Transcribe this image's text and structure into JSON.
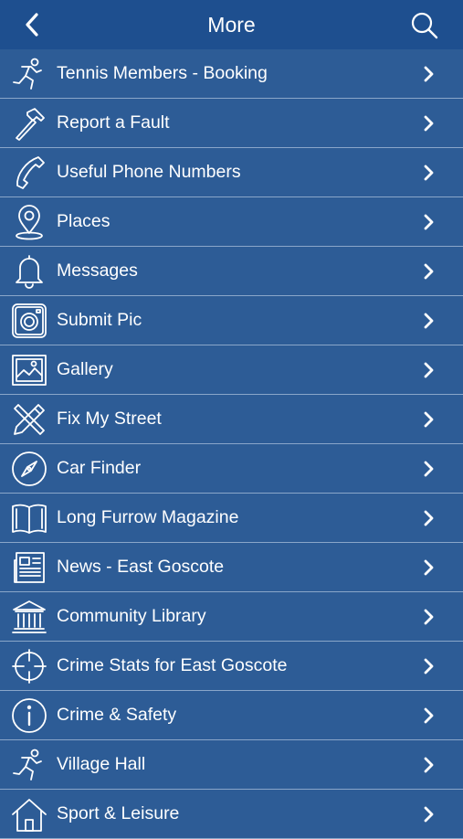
{
  "header": {
    "title": "More",
    "back_icon": "chevron-left-icon",
    "search_icon": "search-icon"
  },
  "colors": {
    "header_bg": "#1e4f8f",
    "list_bg": "#2d5c96",
    "divider": "#8aa6c9",
    "text": "#ffffff"
  },
  "items": [
    {
      "label": "Tennis Members - Booking",
      "icon": "running-person-icon"
    },
    {
      "label": "Report a Fault",
      "icon": "hammer-icon"
    },
    {
      "label": "Useful Phone Numbers",
      "icon": "phone-icon"
    },
    {
      "label": "Places",
      "icon": "map-pin-icon"
    },
    {
      "label": "Messages",
      "icon": "bell-icon"
    },
    {
      "label": "Submit Pic",
      "icon": "camera-icon"
    },
    {
      "label": "Gallery",
      "icon": "picture-icon"
    },
    {
      "label": "Fix My Street",
      "icon": "tools-icon"
    },
    {
      "label": "Car Finder",
      "icon": "compass-icon"
    },
    {
      "label": "Long Furrow Magazine",
      "icon": "open-book-icon"
    },
    {
      "label": "News - East Goscote",
      "icon": "newspaper-icon"
    },
    {
      "label": "Community Library",
      "icon": "library-building-icon"
    },
    {
      "label": "Crime Stats for East Goscote",
      "icon": "crosshair-icon"
    },
    {
      "label": "Crime & Safety",
      "icon": "info-icon"
    },
    {
      "label": "Village Hall",
      "icon": "running-person-icon"
    },
    {
      "label": "Sport & Leisure",
      "icon": "house-icon"
    }
  ]
}
